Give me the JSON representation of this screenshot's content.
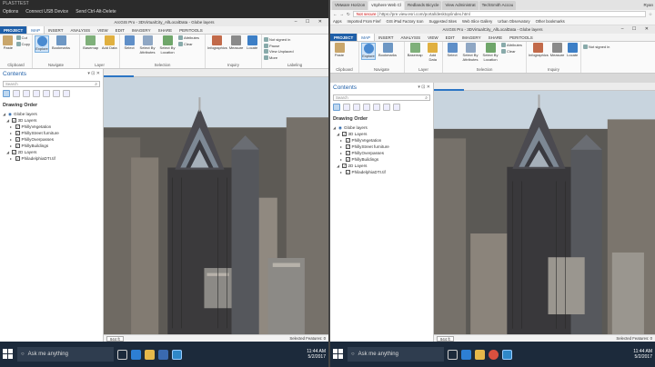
{
  "left": {
    "topbar": {
      "title": "PLASTTEST",
      "options": "Options",
      "connect": "Connect USB Device",
      "send": "Send Ctrl-Alt-Delete"
    },
    "app_title": "ArcGIS Pro - 3DVirtualCity_AllLocalData - Globe layers"
  },
  "right": {
    "browser_tabs": [
      "VMware Horizon",
      "vSphere Web Cl",
      "Redlands Bicycle",
      "View Administrat",
      "TechSmith Accou"
    ],
    "user": "Ryan",
    "address": {
      "not_secure": "Not secure",
      "url": "https://pre.view.esri.com/portal/desktop/index.html"
    },
    "bookmarks": [
      "Apps",
      "Imported From Firef",
      "GIS iPad Factory Icon",
      "Suggested Sites",
      "Web Slice Gallery",
      "Urban Observatory",
      "Other bookmarks"
    ],
    "app_title": "ArcGIS Pro - 3DVirtualCity_AllLocalData - Globe layers"
  },
  "ribbon": {
    "tabs": [
      "PROJECT",
      "MAP",
      "INSERT",
      "ANALYSIS",
      "VIEW",
      "EDIT",
      "IMAGERY",
      "SHARE",
      "PERITOOLS"
    ],
    "clipboard": {
      "paste": "Paste",
      "cut": "Cut",
      "copy": "Copy",
      "label": "Clipboard"
    },
    "navigate": {
      "explore": "Explore",
      "bookmarks": "Bookmarks",
      "label": "Navigate"
    },
    "layer": {
      "basemap": "Basemap",
      "add_data": "Add Data",
      "label": "Layer"
    },
    "selection": {
      "select": "Select",
      "by_attributes": "Select By Attributes",
      "by_location": "Select By Location",
      "attributes": "Attributes",
      "clear": "Clear",
      "label": "Selection"
    },
    "inquiry": {
      "infographics": "Infographics",
      "measure": "Measure",
      "locate": "Locate",
      "label": "Inquiry"
    },
    "labeling": {
      "pause": "Pause",
      "view_unplaced": "View Unplaced",
      "more": "More",
      "label": "Labeling"
    },
    "signin": "Not signed in"
  },
  "contents": {
    "title": "Contents",
    "search_placeholder": "Search",
    "drawing_order": "Drawing Order",
    "globe": "Globe layers",
    "groups": [
      {
        "name": "3D Layers",
        "items": [
          "PhillyVegetation",
          "PhillyStreet furniture",
          "PhillyOverpasses",
          "PhillyBuildings"
        ]
      },
      {
        "name": "2D Layers",
        "items": [
          "PhiladelphiaDTI.tif"
        ]
      }
    ]
  },
  "view": {
    "tab": "Globe layers",
    "scale": "944 ft",
    "status": "Selected Features: 0"
  },
  "taskbar": {
    "search": "Ask me anything",
    "time": "11:44 AM",
    "date": "5/2/2017"
  },
  "colors": {
    "accent": "#1f5fa8",
    "sky": "#c8d4de",
    "taskbar": "#1c2a3b"
  }
}
